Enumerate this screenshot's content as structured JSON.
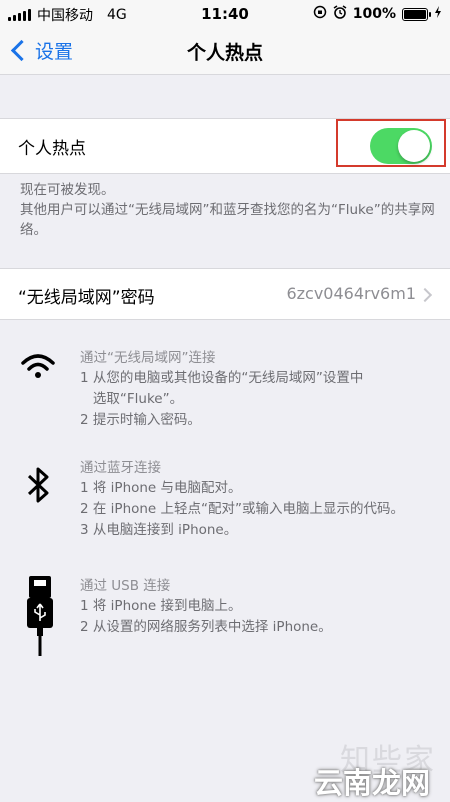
{
  "status_bar": {
    "carrier": "中国移动",
    "network": "4G",
    "time": "11:40",
    "battery": "100%"
  },
  "nav": {
    "back_label": "设置",
    "title": "个人热点"
  },
  "hotspot": {
    "label": "个人热点",
    "toggle_on": true,
    "note1": "现在可被发现。",
    "note2": "其他用户可以通过“无线局域网”和蓝牙查找您的名为“Fluke”的共享网络。"
  },
  "wifi_password": {
    "label": "“无线局域网”密码",
    "value": "6zcv0464rv6m1"
  },
  "sections": [
    {
      "icon": "wifi-icon",
      "title": "通过“无线局域网”连接",
      "steps": [
        "1 从您的电脑或其他设备的“无线局域网”设置中",
        "   选取“Fluke”。",
        "2 提示时输入密码。"
      ]
    },
    {
      "icon": "bluetooth-icon",
      "title": "通过蓝牙连接",
      "steps": [
        "1 将 iPhone 与电脑配对。",
        "2 在 iPhone 上轻点“配对”或输入电脑上显示的代码。",
        "3 从电脑连接到 iPhone。"
      ]
    },
    {
      "icon": "usb-icon",
      "title": "通过 USB 连接",
      "steps": [
        "1 将 iPhone 接到电脑上。",
        "2 从设置的网络服务列表中选择 iPhone。"
      ]
    }
  ],
  "watermarks": [
    "知些家",
    "云南龙网"
  ],
  "colors": {
    "accent": "#1a73e8",
    "toggle_on": "#4cd964",
    "highlight_border": "#d43a2c"
  }
}
